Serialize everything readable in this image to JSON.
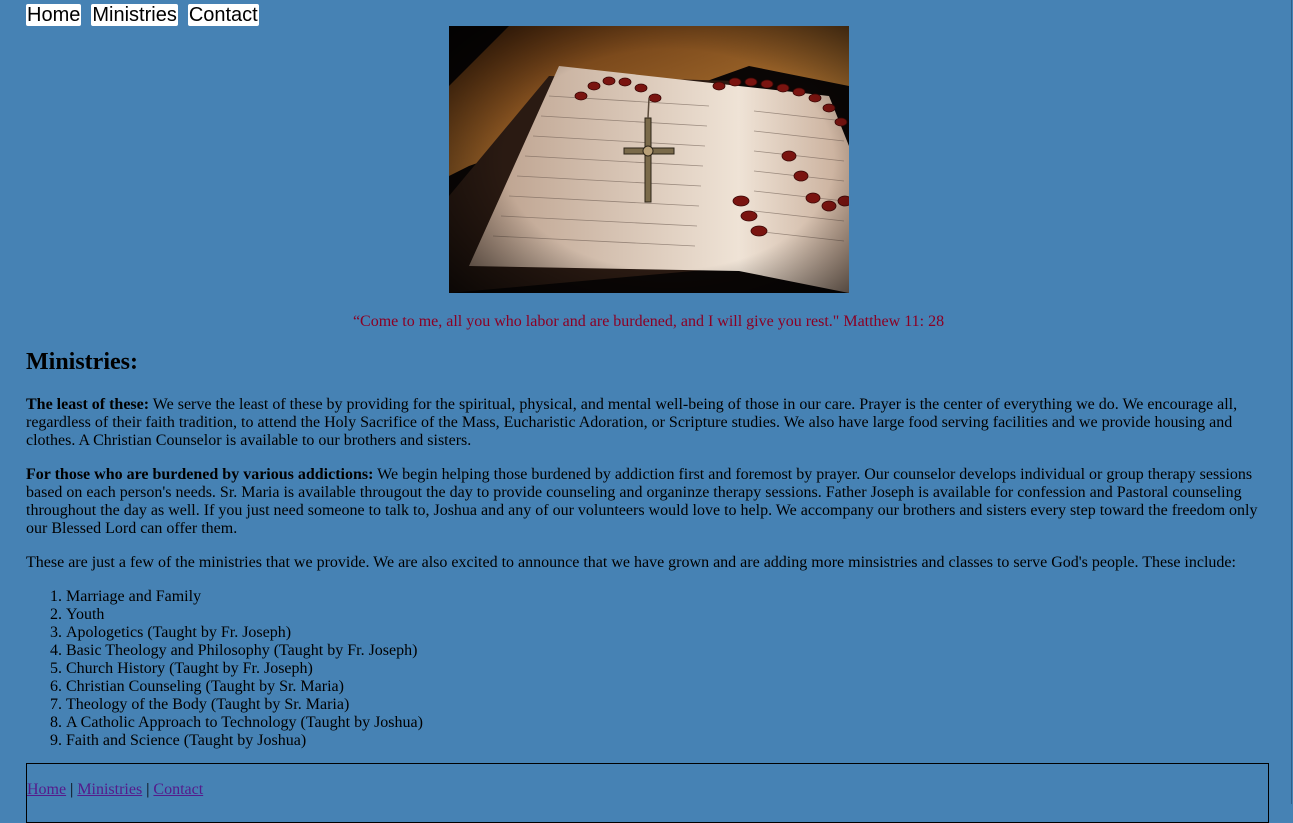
{
  "nav": {
    "items": [
      "Home",
      "Ministries",
      "Contact"
    ]
  },
  "hero": {
    "image_desc": "Open Bible with red rosary and crucifix"
  },
  "quote": "“Come to me, all you who labor and are burdened, and I will give you rest.\" Matthew 11: 28",
  "ministries": {
    "heading": "Ministries:",
    "p1_bold": "The least of these:",
    "p1_text": " We serve the least of these by providing for the spiritual, physical, and mental well-being of those in our care. Prayer is the center of everything we do. We encourage all, regardless of their faith tradition, to attend the Holy Sacrifice of the Mass, Eucharistic Adoration, or Scripture studies. We also have large food serving facilities and we provide housing and clothes. A Christian Counselor is available to our brothers and sisters.",
    "p2_bold": "For those who are burdened by various addictions:",
    "p2_text": " We begin helping those burdened by addiction first and foremost by prayer. Our counselor develops individual or group therapy sessions based on each person's needs. Sr. Maria is available througout the day to provide counseling and organinze therapy sessions. Father Joseph is available for confession and Pastoral counseling throughout the day as well. If you just need someone to talk to, Joshua and any of our volunteers would love to help. We accompany our brothers and sisters every step toward the freedom only our Blessed Lord can offer them.",
    "p3_text": "These are just a few of the ministries that we provide. We are also excited to announce that we have grown and are adding more minsistries and classes to serve God's people. These include:",
    "list": [
      "Marriage and Family",
      "Youth",
      "Apologetics (Taught by Fr. Joseph)",
      "Basic Theology and Philosophy (Taught by Fr. Joseph)",
      "Church History (Taught by Fr. Joseph)",
      "Christian Counseling (Taught by Sr. Maria)",
      "Theology of the Body (Taught by Sr. Maria)",
      "A Catholic Approach to Technology (Taught by Joshua)",
      "Faith and Science (Taught by Joshua)"
    ]
  },
  "footer": {
    "links": [
      "Home",
      "Ministries",
      "Contact"
    ],
    "separator": "|"
  }
}
